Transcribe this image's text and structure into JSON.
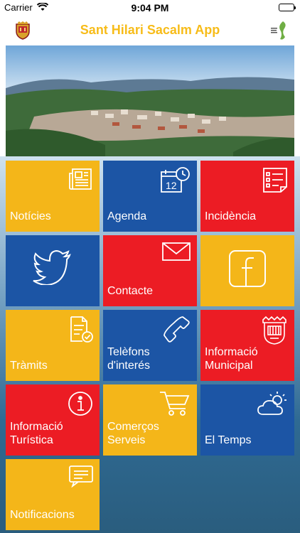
{
  "status": {
    "carrier": "Carrier",
    "time": "9:04 PM"
  },
  "navbar": {
    "title": "Sant Hilari Sacalm App"
  },
  "tiles": [
    {
      "label": "Notícies",
      "color": "#f4b619",
      "icon": "newspaper-icon"
    },
    {
      "label": "Agenda",
      "color": "#1c55a5",
      "icon": "calendar-clock-icon"
    },
    {
      "label": "Incidència",
      "color": "#ec1c24",
      "icon": "checklist-icon"
    },
    {
      "label": "",
      "color": "#1c55a5",
      "icon": "twitter-bird-icon"
    },
    {
      "label": "Contacte",
      "color": "#ec1c24",
      "icon": "envelope-icon"
    },
    {
      "label": "",
      "color": "#f4b619",
      "icon": "facebook-icon"
    },
    {
      "label": "Tràmits",
      "color": "#f4b619",
      "icon": "document-check-icon"
    },
    {
      "label": "Telèfons\nd'interés",
      "color": "#1c55a5",
      "icon": "phone-icon"
    },
    {
      "label": "Informació\nMunicipal",
      "color": "#ec1c24",
      "icon": "town-hall-icon"
    },
    {
      "label": "Informació\nTurística",
      "color": "#ec1c24",
      "icon": "info-icon"
    },
    {
      "label": "Comerços\nServeis",
      "color": "#f4b619",
      "icon": "shopping-cart-icon"
    },
    {
      "label": "El Temps",
      "color": "#1c55a5",
      "icon": "weather-icon"
    },
    {
      "label": "Notificacions",
      "color": "#f4b619",
      "icon": "chat-bubble-icon"
    }
  ]
}
